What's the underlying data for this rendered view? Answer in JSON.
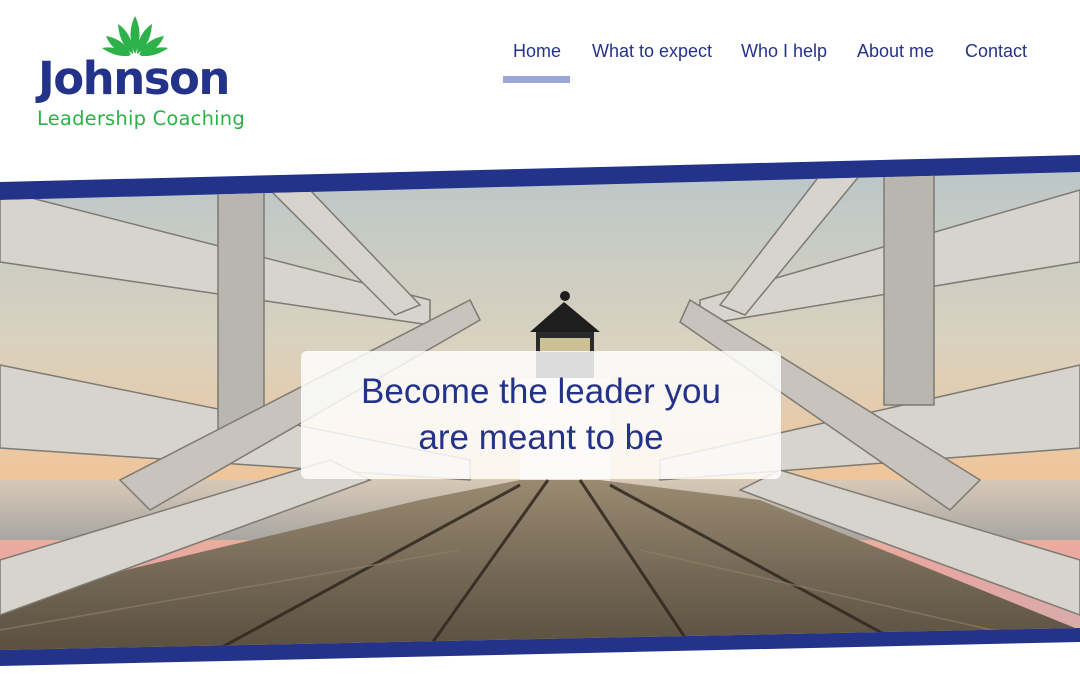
{
  "logo": {
    "name": "Johnson",
    "subtitle": "Leadership Coaching",
    "leaf_color": "#2db24a",
    "name_color": "#24338a",
    "icon": "lotus-leaf-icon"
  },
  "nav": {
    "items": [
      {
        "label": "Home",
        "active": true
      },
      {
        "label": "What to expect",
        "active": false
      },
      {
        "label": "Who I help",
        "active": false
      },
      {
        "label": "About me",
        "active": false
      },
      {
        "label": "Contact",
        "active": false
      }
    ],
    "active_underline_color": "#9ba6d4"
  },
  "hero": {
    "tagline_line1": "Become the leader you",
    "tagline_line2": "are meant to be",
    "accent_color": "#24338a",
    "image": "wooden-pier-to-lighthouse-at-sunset"
  }
}
